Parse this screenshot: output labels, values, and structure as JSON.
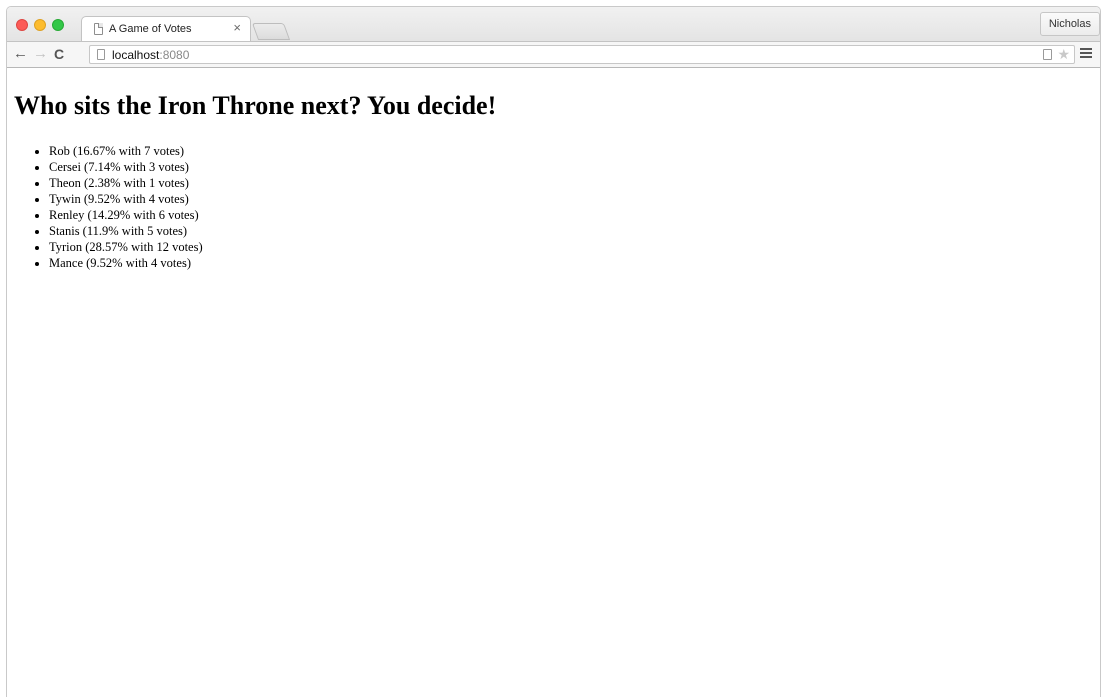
{
  "browser": {
    "tab": {
      "title": "A Game of Votes",
      "close_glyph": "×"
    },
    "profile_name": "Nicholas",
    "omnibox": {
      "host": "localhost",
      "port": ":8080"
    },
    "toolbar": {
      "back_glyph": "←",
      "forward_glyph": "→",
      "reload_glyph": "C",
      "star_glyph": "★"
    },
    "icons": [
      "page-icon",
      "close-icon",
      "back-icon",
      "forward-icon",
      "reload-icon",
      "document-icon",
      "star-icon",
      "menu-icon"
    ]
  },
  "page": {
    "heading": "Who sits the Iron Throne next? You decide!",
    "candidates": [
      {
        "label": "Rob (16.67% with 7 votes)",
        "name": "Rob",
        "percent": 16.67,
        "votes": 7
      },
      {
        "label": "Cersei (7.14% with 3 votes)",
        "name": "Cersei",
        "percent": 7.14,
        "votes": 3
      },
      {
        "label": "Theon (2.38% with 1 votes)",
        "name": "Theon",
        "percent": 2.38,
        "votes": 1
      },
      {
        "label": "Tywin (9.52% with 4 votes)",
        "name": "Tywin",
        "percent": 9.52,
        "votes": 4
      },
      {
        "label": "Renley (14.29% with 6 votes)",
        "name": "Renley",
        "percent": 14.29,
        "votes": 6
      },
      {
        "label": "Stanis (11.9% with 5 votes)",
        "name": "Stanis",
        "percent": 11.9,
        "votes": 5
      },
      {
        "label": "Tyrion (28.57% with 12 votes)",
        "name": "Tyrion",
        "percent": 28.57,
        "votes": 12
      },
      {
        "label": "Mance (9.52% with 4 votes)",
        "name": "Mance",
        "percent": 9.52,
        "votes": 4
      }
    ]
  },
  "colors": {
    "close_red": "#fc5b57",
    "minimize_yellow": "#fdbc2e",
    "zoom_green": "#33c748"
  }
}
